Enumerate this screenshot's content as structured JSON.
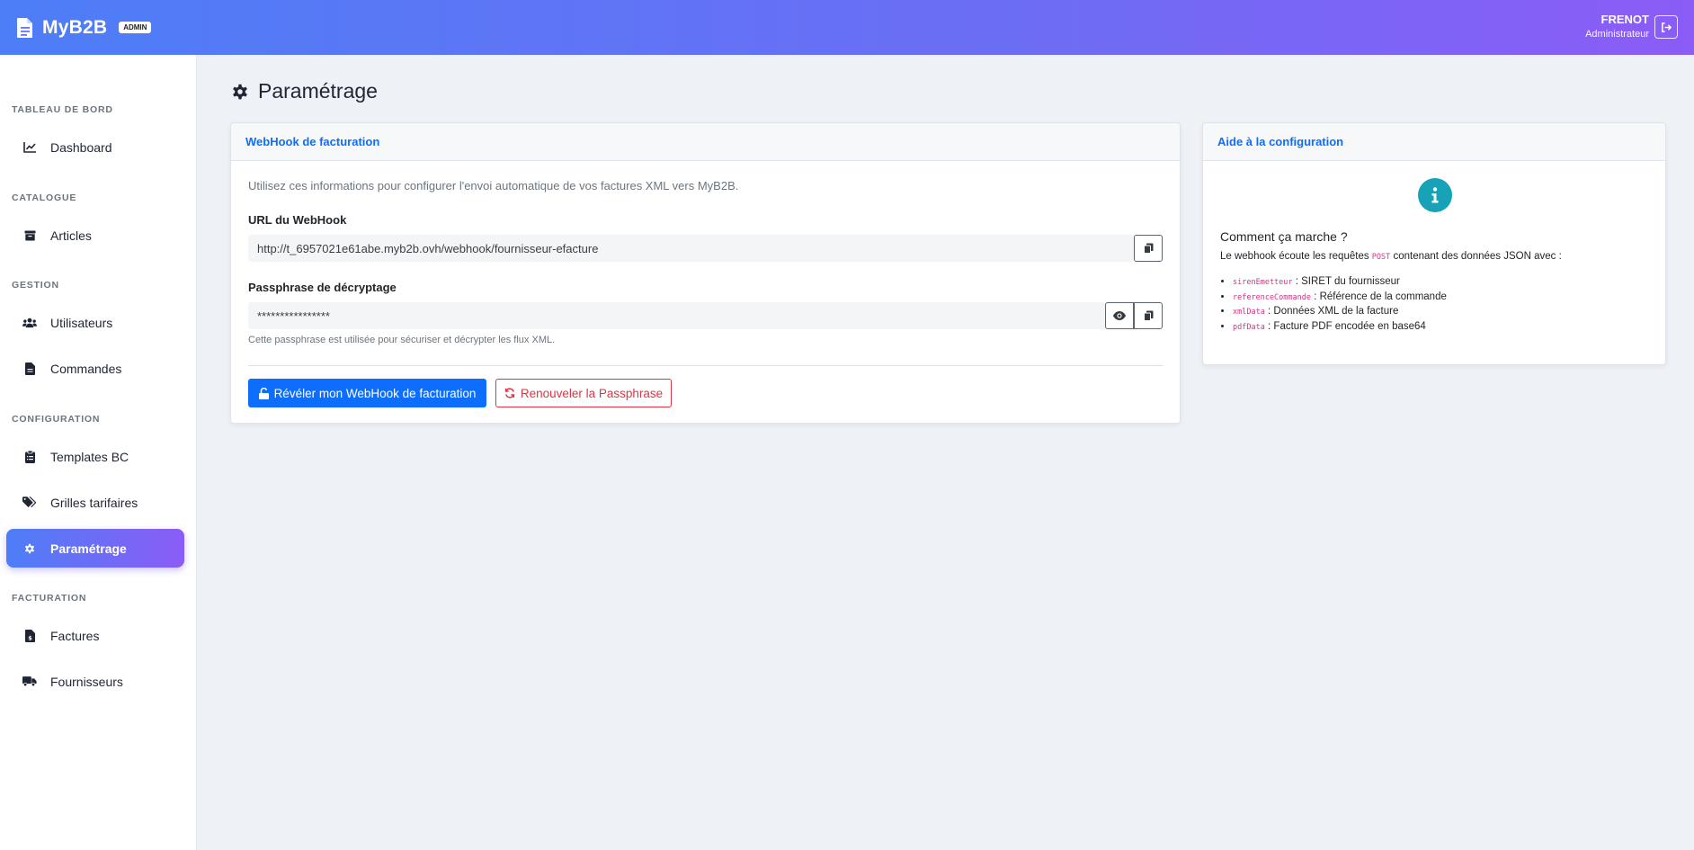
{
  "header": {
    "brand": "MyB2B",
    "badge": "ADMIN",
    "user_name": "FRENOT",
    "user_role": "Administrateur"
  },
  "sidebar": {
    "sections": [
      {
        "title": "TABLEAU DE BORD"
      },
      {
        "title": "CATALOGUE"
      },
      {
        "title": "GESTION"
      },
      {
        "title": "CONFIGURATION"
      },
      {
        "title": "FACTURATION"
      }
    ],
    "items": [
      {
        "label": "Dashboard",
        "icon": "chart-line-icon"
      },
      {
        "label": "Articles",
        "icon": "box-icon"
      },
      {
        "label": "Utilisateurs",
        "icon": "users-icon"
      },
      {
        "label": "Commandes",
        "icon": "file-icon"
      },
      {
        "label": "Templates BC",
        "icon": "clipboard-icon"
      },
      {
        "label": "Grilles tarifaires",
        "icon": "tags-icon"
      },
      {
        "label": "Paramétrage",
        "icon": "gear-icon",
        "active": true
      },
      {
        "label": "Factures",
        "icon": "invoice-icon"
      },
      {
        "label": "Fournisseurs",
        "icon": "truck-icon"
      }
    ]
  },
  "page": {
    "title": "Paramétrage"
  },
  "webhook_card": {
    "title": "WebHook de facturation",
    "intro": "Utilisez ces informations pour configurer l'envoi automatique de vos factures XML vers MyB2B.",
    "url_label": "URL du WebHook",
    "url_value": "http://t_6957021e61abe.myb2b.ovh/webhook/fournisseur-efacture",
    "passphrase_label": "Passphrase de décryptage",
    "passphrase_value": "****************",
    "passphrase_hint": "Cette passphrase est utilisée pour sécuriser et décrypter les flux XML.",
    "reveal_button": "Révéler mon WebHook de facturation",
    "renew_button": "Renouveler la Passphrase"
  },
  "help_card": {
    "title": "Aide à la configuration",
    "heading": "Comment ça marche ?",
    "desc_before": "Le webhook écoute les requêtes",
    "desc_code": "POST",
    "desc_after": "contenant des données JSON avec :",
    "fields": [
      {
        "code": "sirenEmetteur",
        "text": ": SIRET du fournisseur"
      },
      {
        "code": "referenceCommande",
        "text": ": Référence de la commande"
      },
      {
        "code": "xmlData",
        "text": ": Données XML de la facture"
      },
      {
        "code": "pdfData",
        "text": ": Facture PDF encodée en base64"
      }
    ]
  },
  "colors": {
    "accent_start": "#4d7ef7",
    "accent_end": "#8b5cf6",
    "primary": "#0d6efd",
    "danger": "#dc3545",
    "info": "#17a2b8"
  }
}
